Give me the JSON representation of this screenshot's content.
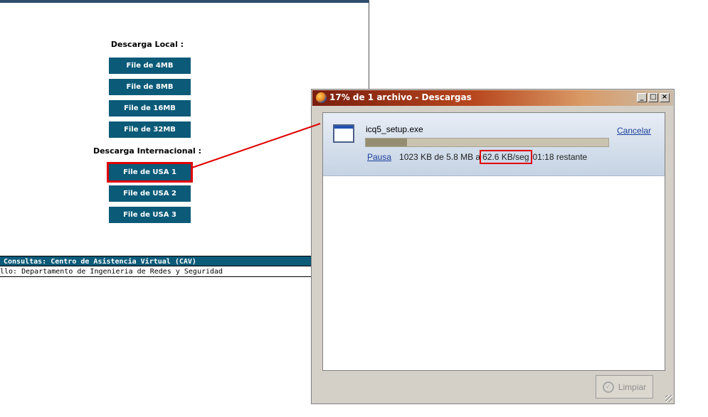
{
  "web_page": {
    "local_heading": "Descarga Local :",
    "local_buttons": [
      "File de 4MB",
      "File de 8MB",
      "File de 16MB",
      "File de 32MB"
    ],
    "intl_heading": "Descarga Internacional :",
    "intl_buttons": [
      "File de USA 1",
      "File de USA 2",
      "File de USA 3"
    ],
    "footer_consultas": "Consultas: Centro de Asistencia Virtual (CAV)",
    "footer_desarrollo": "llo: Departamento de Ingenieria de Redes y Seguridad"
  },
  "downloads_window": {
    "title": "17% de 1 archivo - Descargas",
    "item": {
      "filename": "icq5_setup.exe",
      "cancel_label": "Cancelar",
      "pause_label": "Pausa",
      "downloaded": "1023 KB de 5.8 MB a",
      "speed": "62.6 KB/seg",
      "remaining": "01:18 restante",
      "progress_fraction": 0.17
    },
    "clear_label": "Limpiar"
  },
  "colors": {
    "button_bg": "#0b5a78",
    "highlight": "#e00000",
    "title_gradient_start": "#7a1e0e"
  }
}
